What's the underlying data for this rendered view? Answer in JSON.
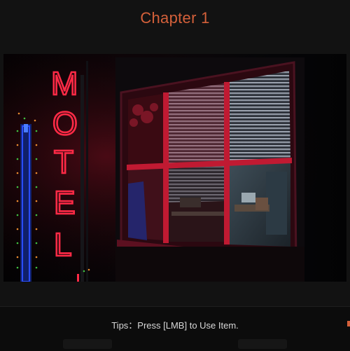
{
  "header": {
    "title": "Chapter 1"
  },
  "scene": {
    "sign_letters": [
      "M",
      "O",
      "T",
      "E",
      "L"
    ],
    "colors": {
      "neon_red": "#ff2a46",
      "neon_blue": "#2a4dff",
      "accent": "#d4603a"
    }
  },
  "footer": {
    "tips": "Tips：Press [LMB] to Use Item."
  }
}
